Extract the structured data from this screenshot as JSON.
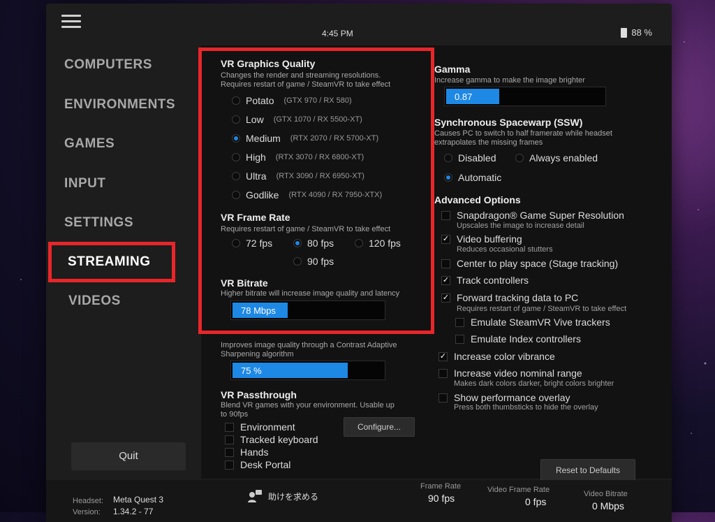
{
  "status": {
    "time": "4:45 PM",
    "battery": "88 %"
  },
  "nav": {
    "items": [
      {
        "label": "COMPUTERS"
      },
      {
        "label": "ENVIRONMENTS"
      },
      {
        "label": "GAMES"
      },
      {
        "label": "INPUT"
      },
      {
        "label": "SETTINGS"
      },
      {
        "label": "STREAMING"
      },
      {
        "label": "VIDEOS"
      }
    ],
    "active": "STREAMING",
    "quit": "Quit"
  },
  "graphics": {
    "title": "VR Graphics Quality",
    "desc1": "Changes the render and streaming resolutions.",
    "desc2": "Requires restart of game / SteamVR to take effect",
    "options": [
      {
        "label": "Potato",
        "gpu": "(GTX 970 / RX 580)",
        "selected": false
      },
      {
        "label": "Low",
        "gpu": "(GTX 1070 / RX 5500-XT)",
        "selected": false
      },
      {
        "label": "Medium",
        "gpu": "(RTX 2070 / RX 5700-XT)",
        "selected": true
      },
      {
        "label": "High",
        "gpu": "(RTX 3070 / RX 6800-XT)",
        "selected": false
      },
      {
        "label": "Ultra",
        "gpu": "(RTX 3090 / RX 6950-XT)",
        "selected": false
      },
      {
        "label": "Godlike",
        "gpu": "(RTX 4090 / RX 7950-XTX)",
        "selected": false
      }
    ]
  },
  "framerate": {
    "title": "VR Frame Rate",
    "desc": "Requires restart of game / SteamVR to take effect",
    "options": [
      "72 fps",
      "80 fps",
      "120 fps",
      "90 fps"
    ],
    "selected": "80 fps"
  },
  "bitrate": {
    "title": "VR Bitrate",
    "desc": "Higher bitrate will increase image quality and latency",
    "value": "78 Mbps",
    "fraction": 0.36
  },
  "sharpening": {
    "desc1": "Improves image quality through a Contrast Adaptive",
    "desc2": "Sharpening algorithm",
    "value": "75 %",
    "fraction": 0.75
  },
  "passthrough": {
    "title": "VR Passthrough",
    "desc1": "Blend VR games with your environment. Usable up",
    "desc2": "to 90fps",
    "items": [
      "Environment",
      "Tracked keyboard",
      "Hands",
      "Desk Portal"
    ],
    "configure": "Configure..."
  },
  "gamma": {
    "title": "Gamma",
    "desc": "Increase gamma to make the image brighter",
    "value": "0.87",
    "fraction": 0.33
  },
  "ssw": {
    "title": "Synchronous Spacewarp (SSW)",
    "desc1": "Causes PC to switch to half framerate while headset",
    "desc2": "extrapolates the missing frames",
    "options": [
      "Disabled",
      "Always enabled",
      "Automatic"
    ],
    "selected": "Automatic"
  },
  "advanced": {
    "title": "Advanced Options",
    "items": [
      {
        "label": "Snapdragon® Game Super Resolution",
        "desc": "Upscales the image to increase detail",
        "checked": false
      },
      {
        "label": "Video buffering",
        "desc": "Reduces occasional stutters",
        "checked": true
      },
      {
        "label": "Center to play space (Stage tracking)",
        "desc": "",
        "checked": false
      },
      {
        "label": "Track controllers",
        "desc": "",
        "checked": true
      },
      {
        "label": "Forward tracking data to PC",
        "desc": "Requires restart of game / SteamVR to take effect",
        "checked": true
      },
      {
        "label": "Emulate SteamVR Vive trackers",
        "desc": "",
        "checked": false
      },
      {
        "label": "Emulate Index controllers",
        "desc": "",
        "checked": false
      },
      {
        "label": "Increase color vibrance",
        "desc": "",
        "checked": true
      },
      {
        "label": "Increase video nominal range",
        "desc": "Makes dark colors darker, bright colors brighter",
        "checked": false
      },
      {
        "label": "Show performance overlay",
        "desc": "Press both thumbsticks to hide the overlay",
        "checked": false
      }
    ],
    "reset": "Reset to Defaults"
  },
  "footer": {
    "headset_label": "Headset:",
    "headset_value": "Meta Quest 3",
    "version_label": "Version:",
    "version_value": "1.34.2 - 77",
    "help": "助けを求める",
    "framerate_label": "Frame Rate",
    "framerate_value": "90 fps",
    "video_framerate_label": "Video Frame Rate",
    "video_framerate_value": "0 fps",
    "video_bitrate_label": "Video Bitrate",
    "video_bitrate_value": "0 Mbps"
  },
  "colors": {
    "accent": "#1e88e5",
    "highlight": "#e8262a",
    "panel": "#1d1d1d"
  }
}
